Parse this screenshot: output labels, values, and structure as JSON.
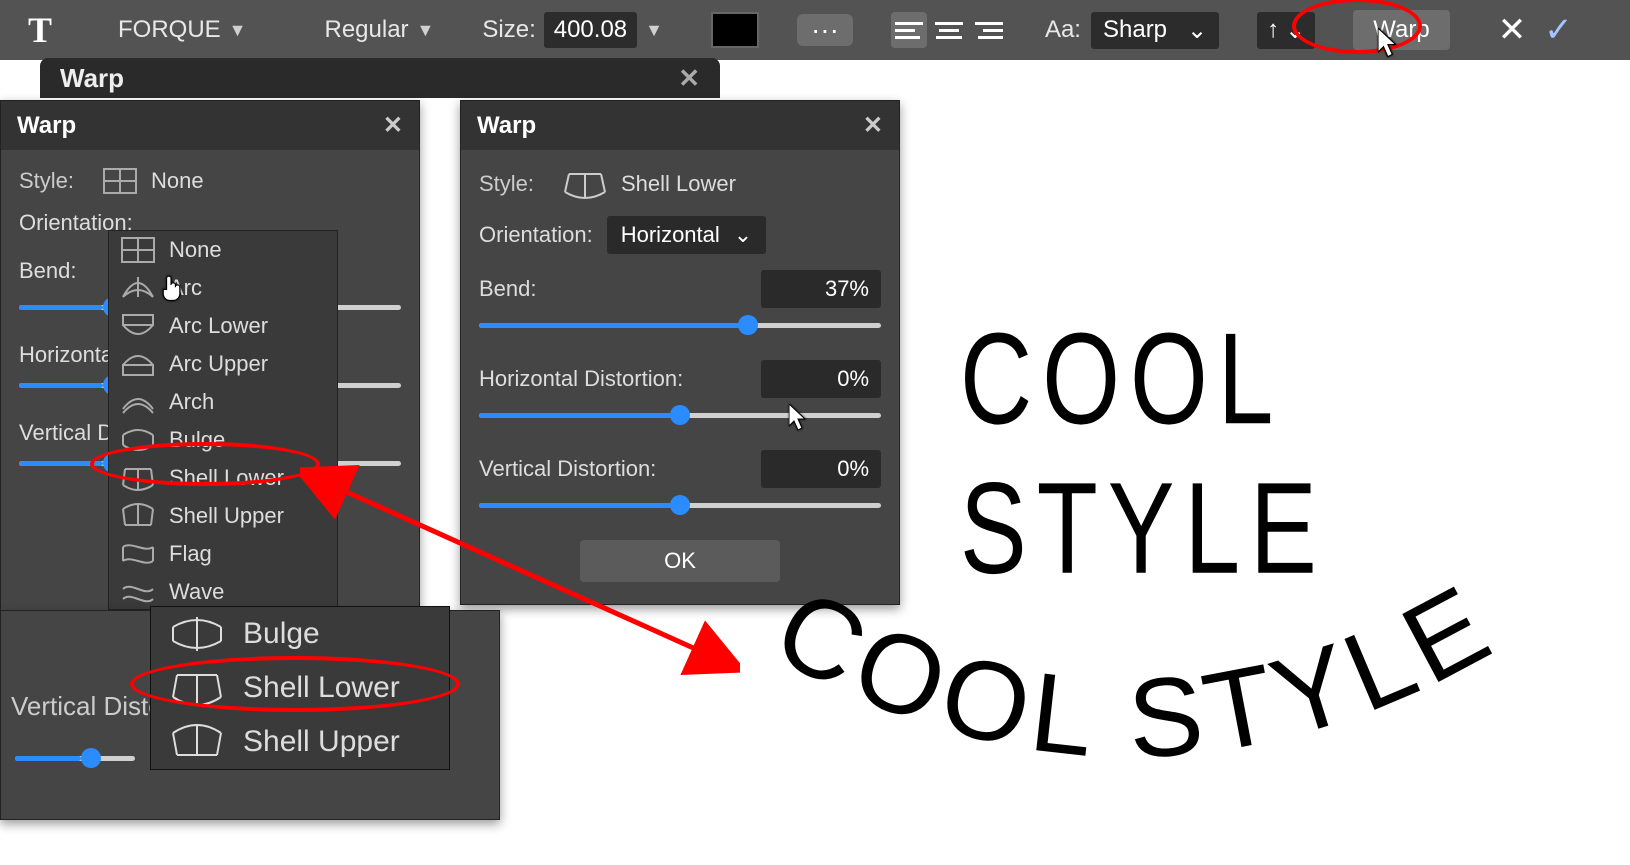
{
  "toolbar": {
    "font_family": "FORQUE",
    "font_style": "Regular",
    "size_label": "Size:",
    "size_value": "400.08",
    "aa_label": "Aa:",
    "aa_value": "Sharp",
    "warp_label": "Warp"
  },
  "tab": {
    "title": "Warp"
  },
  "panel_left": {
    "title": "Warp",
    "style_label": "Style:",
    "style_value": "None",
    "orientation_label": "Orientation:",
    "bend_label": "Bend:",
    "h_label": "Horizontal Distortion:",
    "v_label": "Vertical Distortion:",
    "dropdown_items": [
      "None",
      "Arc",
      "Arc Lower",
      "Arc Upper",
      "Arch",
      "Bulge",
      "Shell Lower",
      "Shell Upper",
      "Flag",
      "Wave"
    ]
  },
  "panel_right": {
    "title": "Warp",
    "style_label": "Style:",
    "style_value": "Shell Lower",
    "orientation_label": "Orientation:",
    "orientation_value": "Horizontal",
    "bend_label": "Bend:",
    "bend_value": "37%",
    "bend_pct": 67,
    "h_label": "Horizontal Distortion:",
    "h_value": "0%",
    "h_pct": 50,
    "v_label": "Vertical Distortion:",
    "v_value": "0%",
    "v_pct": 50,
    "ok_label": "OK"
  },
  "zoom_inset": {
    "items": [
      "Bulge",
      "Shell Lower",
      "Shell Upper"
    ],
    "v_label": "Vertical Distortion:"
  },
  "preview_text": "COOL STYLE"
}
